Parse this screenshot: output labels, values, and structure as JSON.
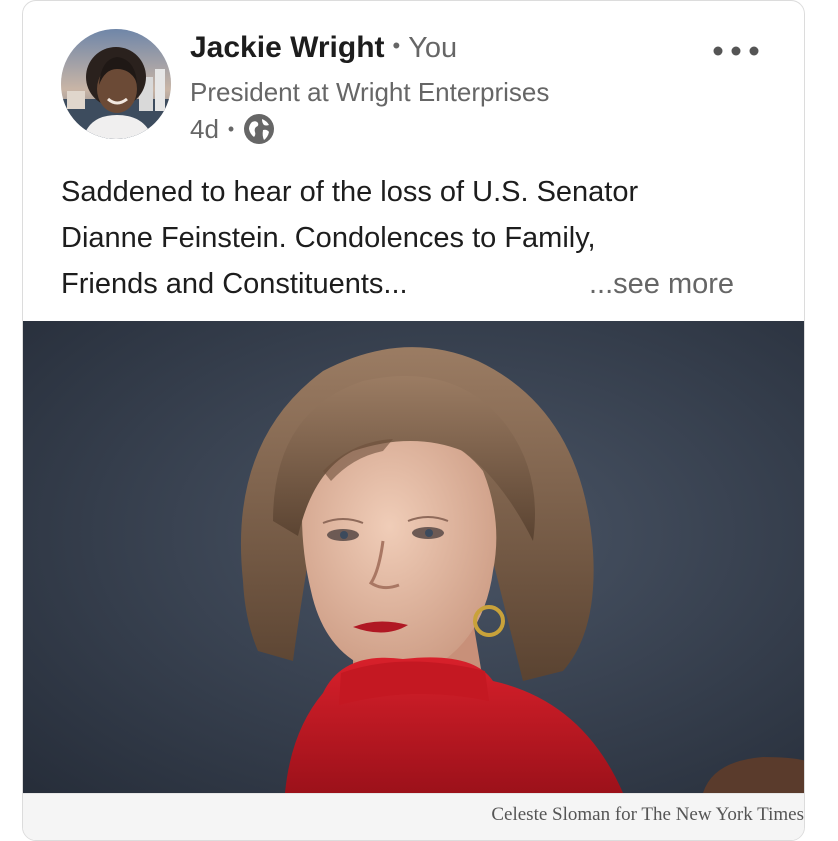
{
  "post": {
    "author_name": "Jackie Wright",
    "separator": "•",
    "relation": "You",
    "headline": "President at Wright Enterprises",
    "age": "4d",
    "meta_separator": "•",
    "visibility_icon": "globe-icon",
    "more_icon": "ellipsis-icon",
    "text_lines": [
      "Saddened to hear of the loss of U.S. Senator",
      "Dianne Feinstein. Condolences to Family,",
      "Friends and Constituents..."
    ],
    "see_more_label": "...see more",
    "image_credit": "Celeste Sloman for The New York Times"
  },
  "colors": {
    "primary_text": "#1d1d1d",
    "secondary_text": "#666666",
    "card_border": "#dcdcdc"
  }
}
